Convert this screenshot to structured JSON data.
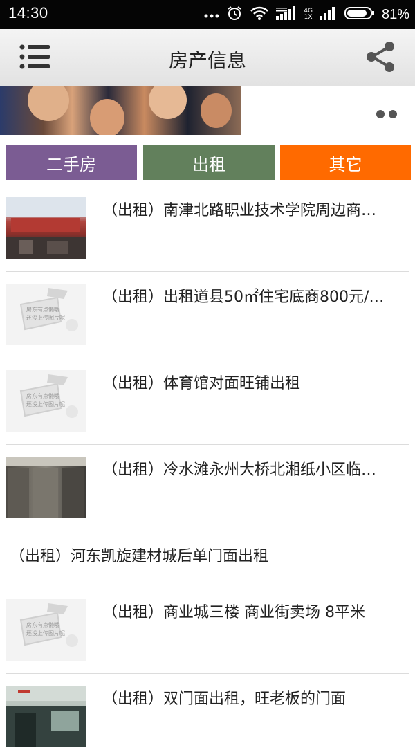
{
  "status_bar": {
    "time": "14:30",
    "network_top": "4G",
    "network_bottom": "1X",
    "battery_text": "81%",
    "battery_level": 0.81
  },
  "header": {
    "title": "房产信息",
    "menu_icon": "menu-icon",
    "share_icon": "share-icon"
  },
  "tabs": [
    {
      "label": "二手房",
      "color": "#7b5c93"
    },
    {
      "label": "出租",
      "color": "#62805c"
    },
    {
      "label": "其它",
      "color": "#ff6a00"
    }
  ],
  "listings": [
    {
      "title": "（出租）南津北路职业技术学院周边商…",
      "thumb": "photo-storefront"
    },
    {
      "title": "（出租）出租道县50㎡住宅底商800元/…",
      "thumb": "placeholder"
    },
    {
      "title": "（出租）体育馆对面旺铺出租",
      "thumb": "placeholder"
    },
    {
      "title": "（出租）冷水滩永州大桥北湘纸小区临…",
      "thumb": "photo-shutters"
    },
    {
      "title": "（出租）河东凯旋建材城后单门面出租",
      "thumb": "none"
    },
    {
      "title": "（出租）商业城三楼 商业街卖场 8平米",
      "thumb": "placeholder"
    },
    {
      "title": "（出租）双门面出租，旺老板的门面",
      "thumb": "photo-shop"
    }
  ],
  "placeholder_text": [
    "房东有点懒哦",
    "还没上传图片呢"
  ]
}
